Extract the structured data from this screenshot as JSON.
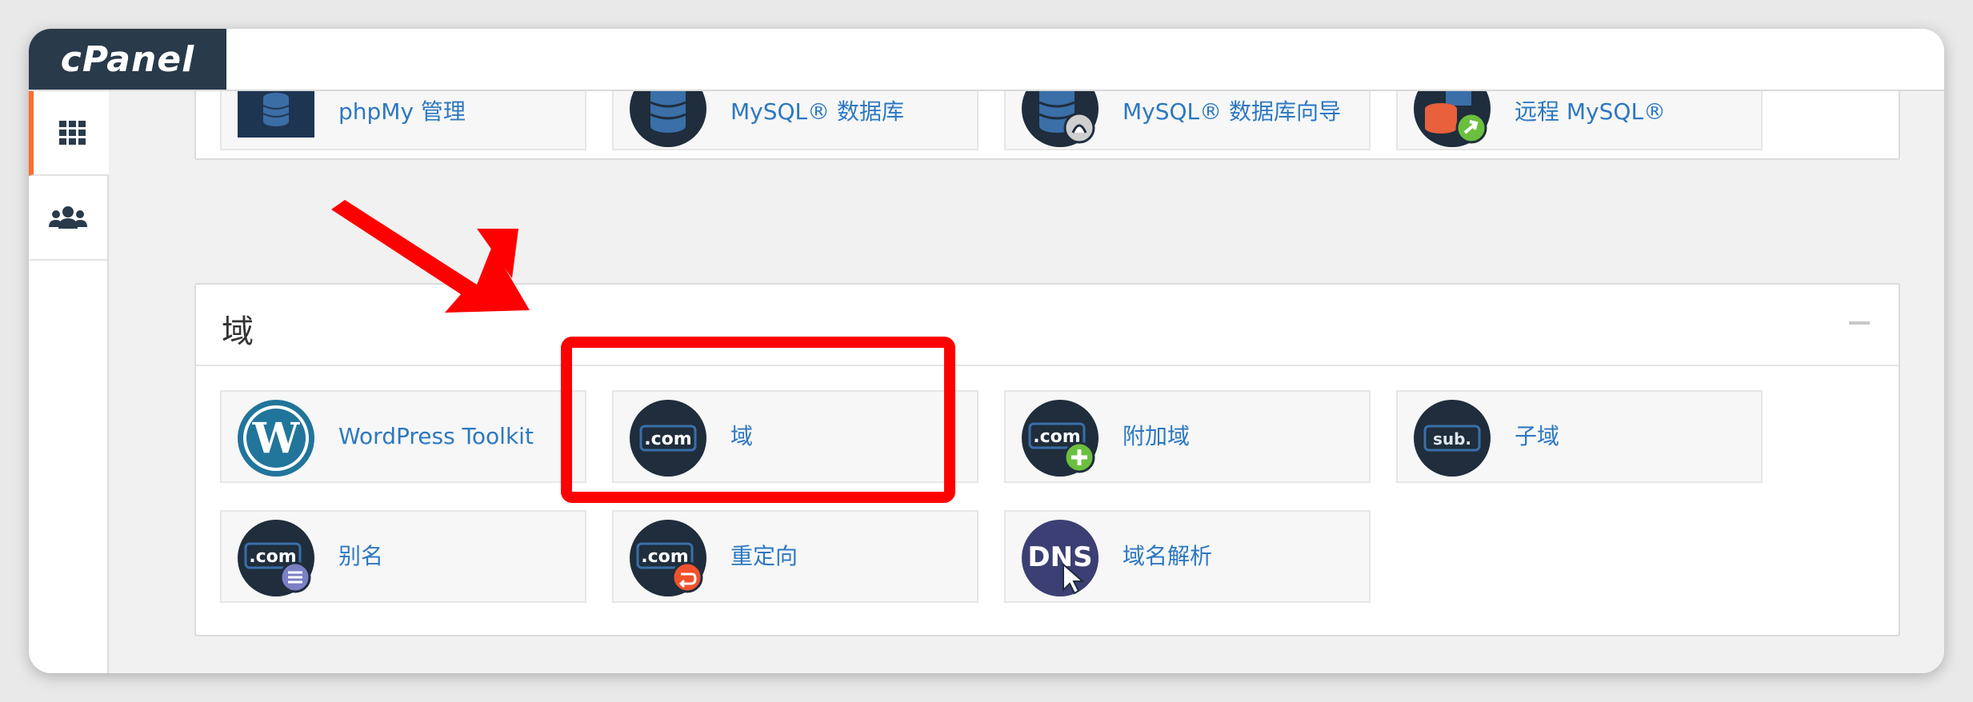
{
  "app": {
    "logo": "cPanel"
  },
  "sidebar": {
    "items": [
      {
        "name": "grid-icon",
        "active": true
      },
      {
        "name": "users-icon",
        "active": false
      }
    ]
  },
  "database_section": {
    "tiles": [
      {
        "label": "phpMy 管理",
        "icon": "phpmyadmin-icon"
      },
      {
        "label": "MySQL® 数据库",
        "icon": "mysql-database-icon"
      },
      {
        "label": "MySQL® 数据库向导",
        "icon": "mysql-wizard-icon"
      },
      {
        "label": "远程 MySQL®",
        "icon": "remote-mysql-icon"
      }
    ]
  },
  "domains_section": {
    "title": "域",
    "tiles": [
      {
        "label": "WordPress Toolkit",
        "icon": "wordpress-icon"
      },
      {
        "label": "域",
        "icon": "domains-icon",
        "icon_text": ".com"
      },
      {
        "label": "附加域",
        "icon": "addon-domain-icon",
        "icon_text": ".com"
      },
      {
        "label": "子域",
        "icon": "subdomain-icon",
        "icon_text": "sub."
      },
      {
        "label": "别名",
        "icon": "alias-icon",
        "icon_text": ".com"
      },
      {
        "label": "重定向",
        "icon": "redirect-icon",
        "icon_text": ".com"
      },
      {
        "label": "域名解析",
        "icon": "dns-icon",
        "icon_text": "DNS"
      }
    ]
  },
  "annotation": {
    "color": "#ff0000"
  },
  "colors": {
    "accent": "#ff6c2c",
    "link": "#2d78c1",
    "logo_bg": "#293a4a"
  }
}
